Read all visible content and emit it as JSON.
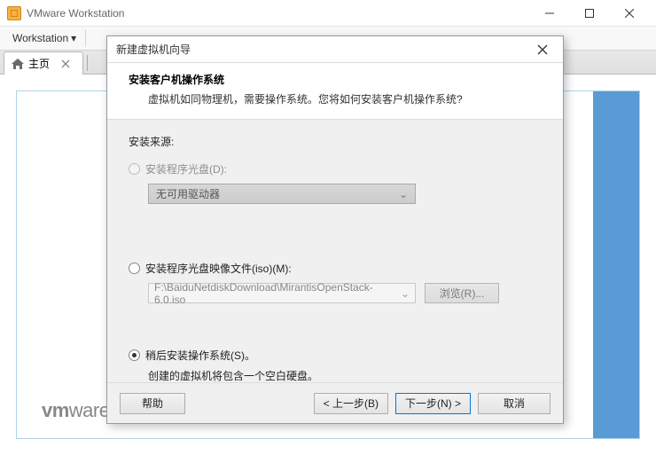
{
  "window": {
    "title": "VMware Workstation",
    "menu": {
      "workstation": "Workstation"
    },
    "tab_home": "主页",
    "logo": {
      "vm": "vm",
      "ware": "ware"
    }
  },
  "dialog": {
    "title": "新建虚拟机向导",
    "heading": "安装客户机操作系统",
    "subheading": "虚拟机如同物理机，需要操作系统。您将如何安装客户机操作系统?",
    "source_label": "安装来源:",
    "opt_disc": "安装程序光盘(D):",
    "disc_combo": "无可用驱动器",
    "opt_iso": "安装程序光盘映像文件(iso)(M):",
    "iso_path": "F:\\BaiduNetdiskDownload\\MirantisOpenStack-6.0.iso",
    "browse": "浏览(R)...",
    "opt_later": "稍后安装操作系统(S)。",
    "later_hint": "创建的虚拟机将包含一个空白硬盘。",
    "buttons": {
      "help": "帮助",
      "back": "< 上一步(B)",
      "next": "下一步(N) >",
      "cancel": "取消"
    }
  }
}
